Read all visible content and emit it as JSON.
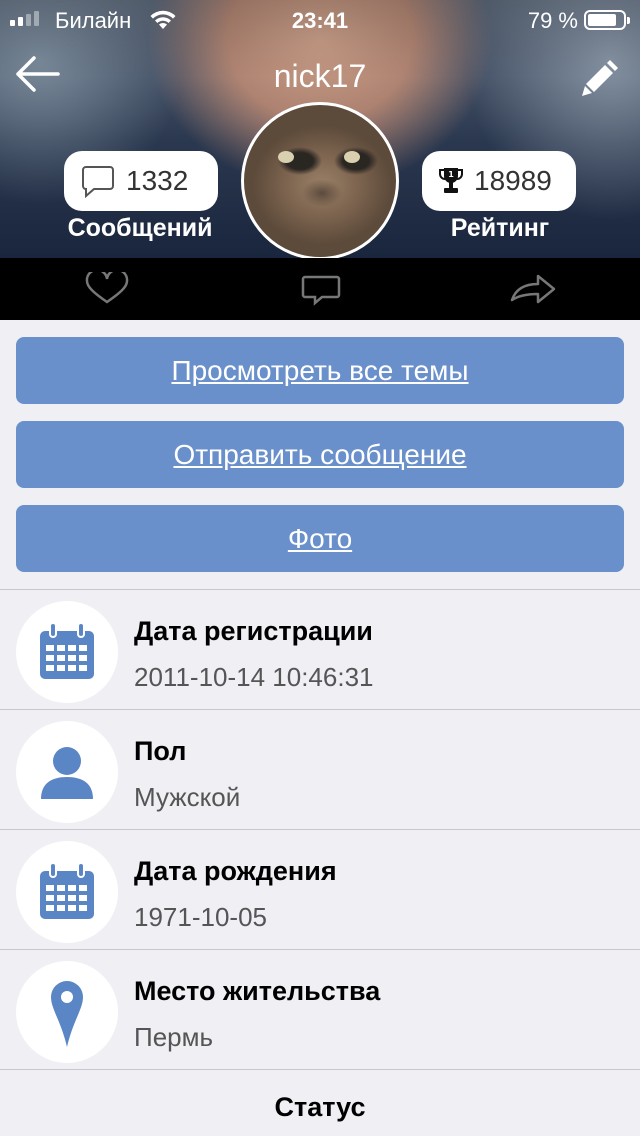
{
  "status_bar": {
    "carrier": "Билайн",
    "time": "23:41",
    "battery_percent": "79 %"
  },
  "profile": {
    "username": "nick17",
    "messages": {
      "count": "1332",
      "label": "Сообщений"
    },
    "rating": {
      "count": "18989",
      "label": "Рейтинг"
    }
  },
  "action_bar": {
    "icons": [
      "heart-icon",
      "comment-icon",
      "share-icon"
    ]
  },
  "buttons": {
    "view_topics": "Просмотреть все темы",
    "send_message": "Отправить сообщение",
    "photo": "Фото"
  },
  "info": [
    {
      "title": "Дата регистрации",
      "value": "2011-10-14 10:46:31",
      "icon": "calendar-icon"
    },
    {
      "title": "Пол",
      "value": "Мужской",
      "icon": "person-icon"
    },
    {
      "title": "Дата рождения",
      "value": "1971-10-05",
      "icon": "calendar-icon"
    },
    {
      "title": "Место жительства",
      "value": "Пермь",
      "icon": "location-pin-icon"
    }
  ],
  "status_section": {
    "title": "Статус"
  },
  "colors": {
    "accent": "#6a90cc",
    "icon_blue": "#5b86c5",
    "background": "#efeff4"
  }
}
